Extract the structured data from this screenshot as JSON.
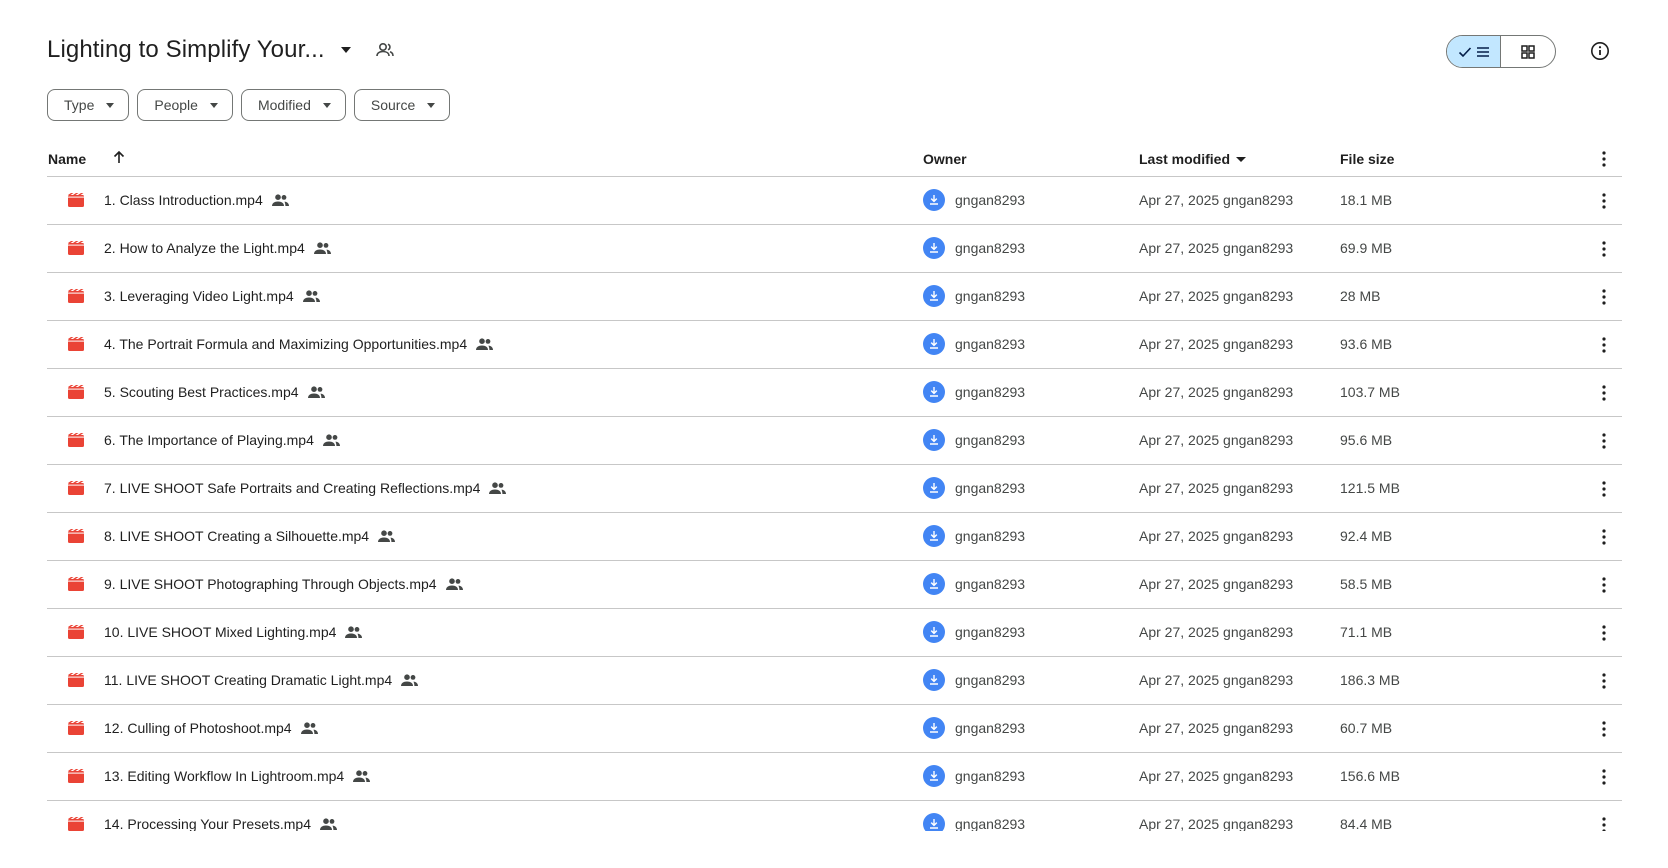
{
  "header": {
    "title": "Lighting to Simplify Your...",
    "view_list_label": "list-view",
    "view_grid_label": "grid-view"
  },
  "filters": {
    "type": "Type",
    "people": "People",
    "modified": "Modified",
    "source": "Source"
  },
  "table": {
    "columns": {
      "name": "Name",
      "owner": "Owner",
      "last_modified": "Last modified",
      "file_size": "File size"
    },
    "rows": [
      {
        "name": "1. Class Introduction.mp4",
        "owner": "gngan8293",
        "modified": "Apr 27, 2025 gngan8293",
        "size": "18.1 MB"
      },
      {
        "name": "2. How to Analyze the Light.mp4",
        "owner": "gngan8293",
        "modified": "Apr 27, 2025 gngan8293",
        "size": "69.9 MB"
      },
      {
        "name": "3. Leveraging Video Light.mp4",
        "owner": "gngan8293",
        "modified": "Apr 27, 2025 gngan8293",
        "size": "28 MB"
      },
      {
        "name": "4. The Portrait Formula and Maximizing Opportunities.mp4",
        "owner": "gngan8293",
        "modified": "Apr 27, 2025 gngan8293",
        "size": "93.6 MB"
      },
      {
        "name": "5. Scouting Best Practices.mp4",
        "owner": "gngan8293",
        "modified": "Apr 27, 2025 gngan8293",
        "size": "103.7 MB"
      },
      {
        "name": "6. The Importance of Playing.mp4",
        "owner": "gngan8293",
        "modified": "Apr 27, 2025 gngan8293",
        "size": "95.6 MB"
      },
      {
        "name": "7. LIVE SHOOT Safe Portraits and Creating Reflections.mp4",
        "owner": "gngan8293",
        "modified": "Apr 27, 2025 gngan8293",
        "size": "121.5 MB"
      },
      {
        "name": "8. LIVE SHOOT Creating a Silhouette.mp4",
        "owner": "gngan8293",
        "modified": "Apr 27, 2025 gngan8293",
        "size": "92.4 MB"
      },
      {
        "name": "9. LIVE SHOOT Photographing Through Objects.mp4",
        "owner": "gngan8293",
        "modified": "Apr 27, 2025 gngan8293",
        "size": "58.5 MB"
      },
      {
        "name": "10. LIVE SHOOT Mixed Lighting.mp4",
        "owner": "gngan8293",
        "modified": "Apr 27, 2025 gngan8293",
        "size": "71.1 MB"
      },
      {
        "name": "11. LIVE SHOOT Creating Dramatic Light.mp4",
        "owner": "gngan8293",
        "modified": "Apr 27, 2025 gngan8293",
        "size": "186.3 MB"
      },
      {
        "name": "12. Culling of Photoshoot.mp4",
        "owner": "gngan8293",
        "modified": "Apr 27, 2025 gngan8293",
        "size": "60.7 MB"
      },
      {
        "name": "13. Editing Workflow In Lightroom.mp4",
        "owner": "gngan8293",
        "modified": "Apr 27, 2025 gngan8293",
        "size": "156.6 MB"
      },
      {
        "name": "14. Processing Your Presets.mp4",
        "owner": "gngan8293",
        "modified": "Apr 27, 2025 gngan8293",
        "size": "84.4 MB"
      }
    ]
  },
  "icons": {
    "file_type": "video-file-icon",
    "shared": "shared-people-icon",
    "avatar": "download-avatar-icon",
    "more": "more-vert-icon"
  },
  "colors": {
    "video_icon": "#ea4335",
    "avatar": "#4285f4",
    "toggle_active": "#c2e7ff",
    "divider": "#c7c7c7"
  }
}
